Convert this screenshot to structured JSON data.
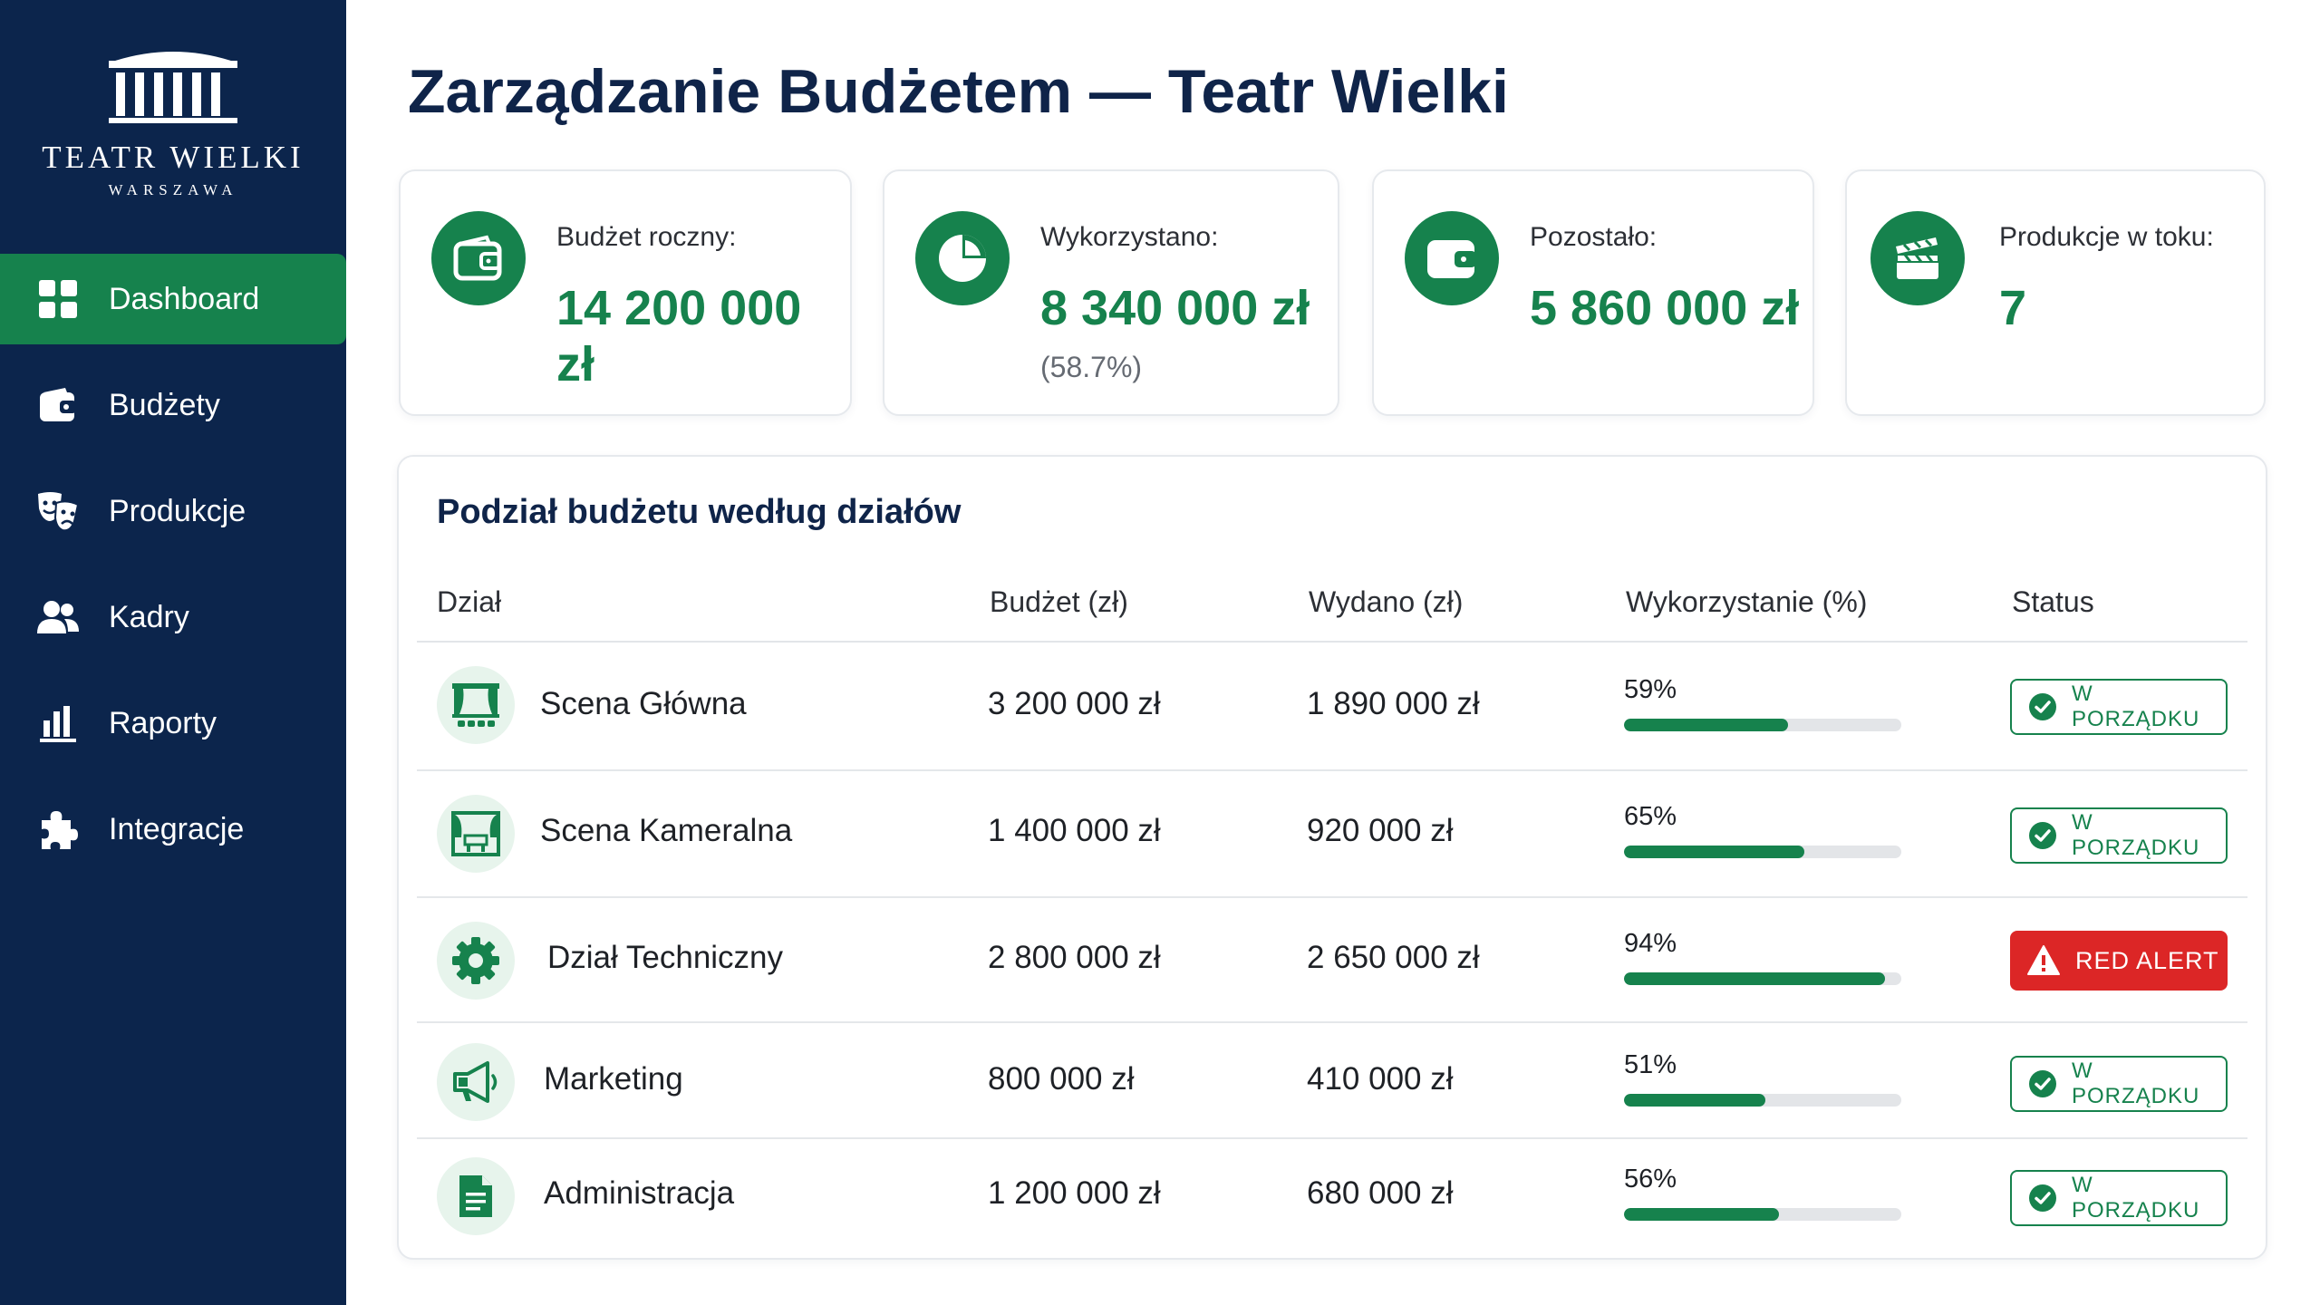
{
  "logo": {
    "name": "TEATR WIELKI",
    "city": "WARSZAWA"
  },
  "nav": [
    {
      "label": "Dashboard",
      "icon": "grid-icon",
      "active": true
    },
    {
      "label": "Budżety",
      "icon": "wallet-icon",
      "active": false
    },
    {
      "label": "Produkcje",
      "icon": "theater-masks-icon",
      "active": false
    },
    {
      "label": "Kadry",
      "icon": "users-icon",
      "active": false
    },
    {
      "label": "Raporty",
      "icon": "bar-chart-icon",
      "active": false
    },
    {
      "label": "Integracje",
      "icon": "puzzle-icon",
      "active": false
    }
  ],
  "page": {
    "title": "Zarządzanie Budżetem — Teatr Wielki"
  },
  "stats": [
    {
      "label": "Budżet roczny:",
      "value": "14 200 000 zł",
      "sub": "",
      "icon": "wallet-icon"
    },
    {
      "label": "Wykorzystano:",
      "value": "8 340 000 zł",
      "sub": "(58.7%)",
      "icon": "pie-chart-icon"
    },
    {
      "label": "Pozostało:",
      "value": "5 860 000 zł",
      "sub": "",
      "icon": "wallet-icon"
    },
    {
      "label": "Produkcje w toku:",
      "value": "7",
      "sub": "",
      "icon": "clapperboard-icon"
    }
  ],
  "table": {
    "title": "Podział budżetu według działów",
    "columns": [
      "Dział",
      "Budżet (zł)",
      "Wydano (zł)",
      "Wykorzystanie (%)",
      "Status"
    ],
    "rows": [
      {
        "name": "Scena Główna",
        "budget": "3 200 000 zł",
        "spent": "1 890 000 zł",
        "percent_label": "59%",
        "percent": 59,
        "status": "W PORZĄDKU",
        "status_type": "ok",
        "icon": "stage-curtain-icon"
      },
      {
        "name": "Scena Kameralna",
        "budget": "1 400 000 zł",
        "spent": "920 000 zł",
        "percent_label": "65%",
        "percent": 65,
        "status": "W PORZĄDKU",
        "status_type": "ok",
        "icon": "small-stage-icon"
      },
      {
        "name": "Dział Techniczny",
        "budget": "2 800 000 zł",
        "spent": "2 650 000 zł",
        "percent_label": "94%",
        "percent": 94,
        "status": "RED ALERT",
        "status_type": "alert",
        "icon": "gear-icon"
      },
      {
        "name": "Marketing",
        "budget": "800 000 zł",
        "spent": "410 000 zł",
        "percent_label": "51%",
        "percent": 51,
        "status": "W PORZĄDKU",
        "status_type": "ok",
        "icon": "megaphone-icon"
      },
      {
        "name": "Administracja",
        "budget": "1 200 000 zł",
        "spent": "680 000 zł",
        "percent_label": "56%",
        "percent": 56,
        "status": "W PORZĄDKU",
        "status_type": "ok",
        "icon": "document-icon"
      }
    ]
  },
  "colors": {
    "sidebar": "#0c254c",
    "accent": "#16824d",
    "alert": "#dc2626",
    "title": "#0f2449"
  }
}
